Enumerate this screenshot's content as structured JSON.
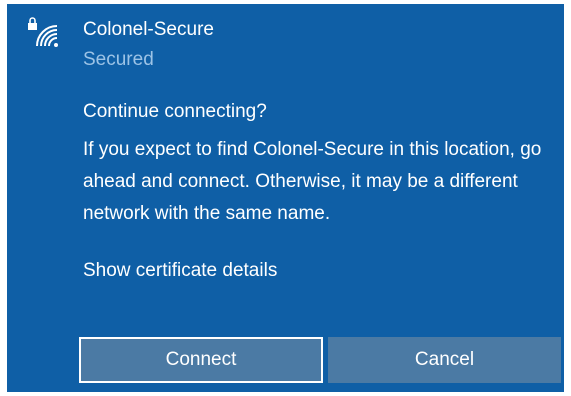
{
  "network": {
    "name": "Colonel-Secure",
    "status": "Secured",
    "icon": "wifi-secured-icon"
  },
  "prompt": {
    "title": "Continue connecting?",
    "body": "If you expect to find Colonel-Secure in this location, go ahead and connect. Otherwise, it may be a different network with the same name.",
    "cert_link": "Show certificate details"
  },
  "buttons": {
    "connect_label": "Connect",
    "cancel_label": "Cancel"
  },
  "colors": {
    "background": "#0f5fa6",
    "secondary_text": "#9cc3e6",
    "button": "#4b7aa4"
  }
}
